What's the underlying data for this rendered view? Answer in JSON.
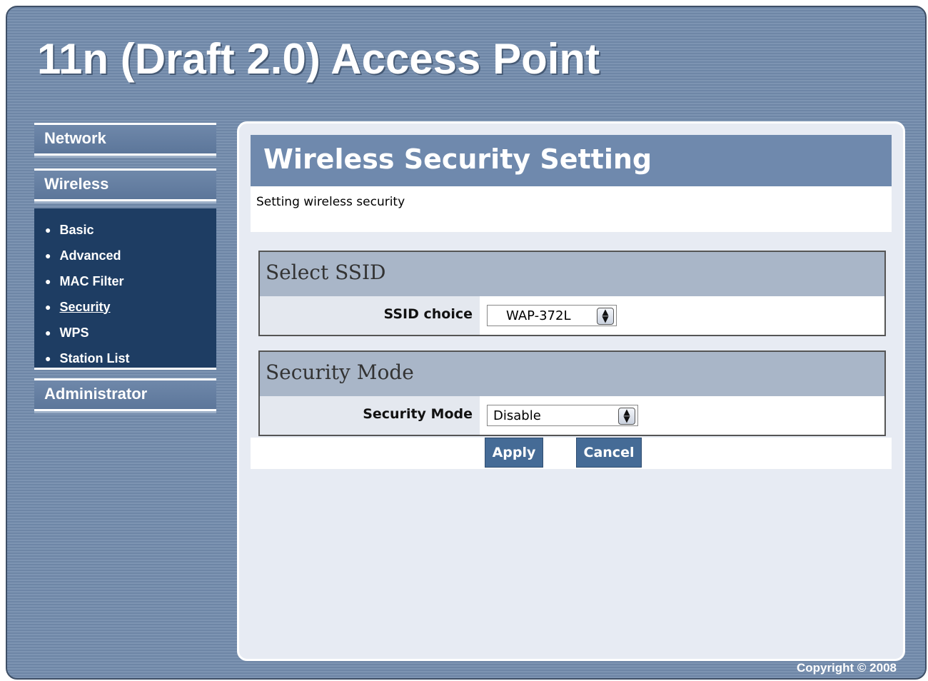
{
  "app": {
    "title": "11n (Draft 2.0) Access Point"
  },
  "sidebar": {
    "network": "Network",
    "wireless": "Wireless",
    "submenu": [
      {
        "label": "Basic"
      },
      {
        "label": "Advanced"
      },
      {
        "label": "MAC Filter"
      },
      {
        "label": "Security",
        "active": true
      },
      {
        "label": "WPS"
      },
      {
        "label": "Station List"
      }
    ],
    "administrator": "Administrator"
  },
  "main": {
    "heading": "Wireless Security Setting",
    "intro": "Setting wireless security",
    "select_ssid": {
      "title": "Select SSID",
      "label": "SSID choice",
      "value": "WAP-372L"
    },
    "security_mode": {
      "title": "Security Mode",
      "label": "Security Mode",
      "value": "Disable"
    },
    "apply_label": "Apply",
    "cancel_label": "Cancel"
  },
  "footer": {
    "copyright": "Copyright © 2008"
  },
  "colors": {
    "frame": "#7d94b2",
    "nav": "#1e3d63",
    "header": "#6f89ad",
    "button": "#456b96"
  }
}
